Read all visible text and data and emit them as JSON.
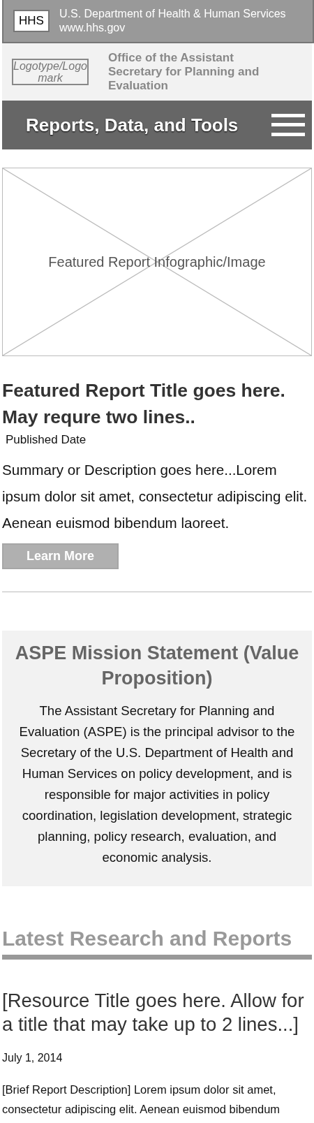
{
  "top_bar": {
    "logo": "HHS",
    "title": "U.S. Department of Health & Human Services",
    "url": "www.hhs.gov"
  },
  "office_bar": {
    "logo": "Logotype/Logomark",
    "name": "Office of the Assistant Secretary for Planning and Evaluation"
  },
  "nav": {
    "title": "Reports, Data, and Tools"
  },
  "featured": {
    "image_label": "Featured Report Infographic/Image",
    "title": "Featured Report Title goes here. May requre two lines..",
    "date": "Published Date",
    "summary": "Summary or Description goes here...Lorem ipsum dolor sit amet, consectetur adipiscing elit. Aenean euismod bibendum laoreet.",
    "button": "Learn More"
  },
  "mission": {
    "title": "ASPE Mission Statement (Value Proposition)",
    "text": "The Assistant Secretary for Planning and Evaluation (ASPE) is the principal advisor to the Secretary of the U.S. Department of Health and Human Services on policy development, and is responsible for major activities in policy coordination, legislation development, strategic planning, policy research, evaluation, and economic analysis."
  },
  "latest": {
    "heading": "Latest Research and Reports",
    "items": [
      {
        "title": "[Resource Title goes here. Allow for a title that may take up to 2 lines...]",
        "date": "July 1, 2014",
        "description": "[Brief Report Description] Lorem ipsum dolor sit amet, consectetur adipiscing elit. Aenean euismod bibendum"
      }
    ]
  }
}
